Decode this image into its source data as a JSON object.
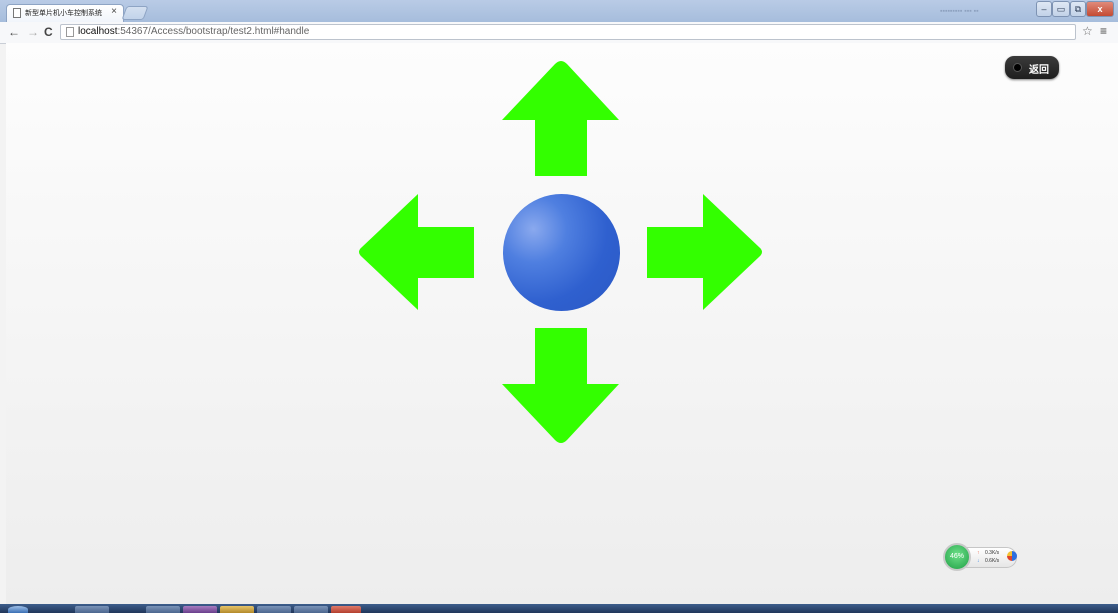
{
  "browser": {
    "tab_title": "新型单片机小车控制系统",
    "tab_close": "×",
    "tabstrip_blur": "▪▪▪▪▪▪▪▪▪ ▪▪▪ ▪▪",
    "nav": {
      "back": "←",
      "forward": "→",
      "reload": "C"
    },
    "url": {
      "host": "localhost",
      "rest": ":54367/Access/bootstrap/test2.html#handle"
    },
    "star": "☆",
    "menu": "≡",
    "window_buttons": {
      "min": "–",
      "restore": "▭",
      "full": "⧉",
      "close": "x"
    }
  },
  "page": {
    "back_button_label": "返回",
    "arrow_color": "#33ff00",
    "ball_color": "#2f60cf",
    "controls": [
      "up",
      "left",
      "right",
      "down"
    ]
  },
  "speed_widget": {
    "percent": "46%",
    "upload": "0.3K/s",
    "download": "0.6K/s",
    "up_arrow": "↑",
    "down_arrow": "↓"
  }
}
